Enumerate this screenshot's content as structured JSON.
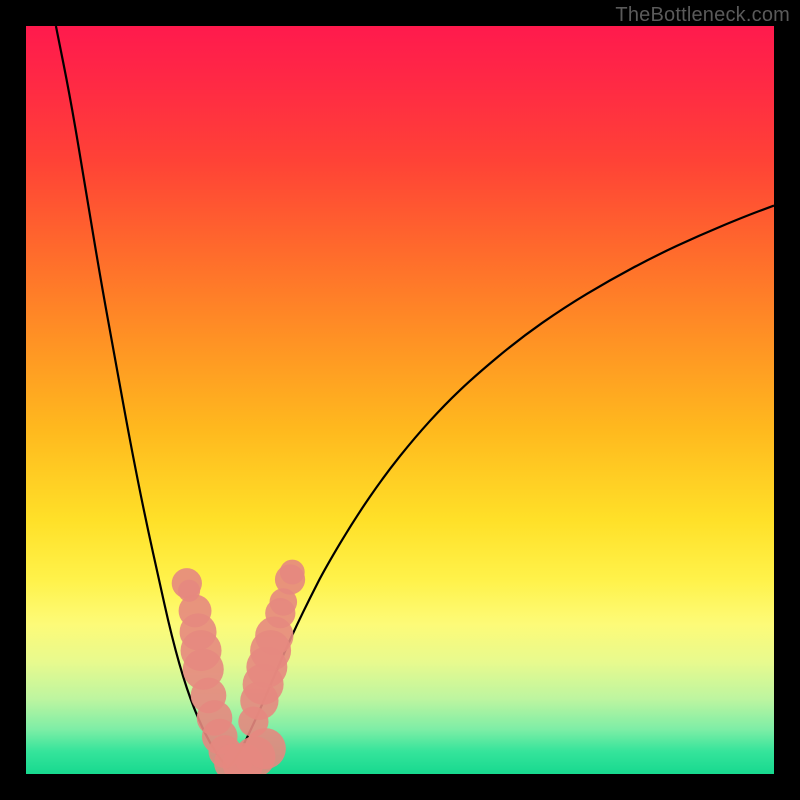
{
  "watermark": "TheBottleneck.com",
  "colors": {
    "curve": "#000000",
    "markers": "#e6887f",
    "frame": "#000000"
  },
  "chart_data": {
    "type": "line",
    "title": "",
    "xlabel": "",
    "ylabel": "",
    "xlim": [
      0,
      100
    ],
    "ylim": [
      0,
      100
    ],
    "grid": false,
    "series": [
      {
        "name": "left-branch",
        "x": [
          4,
          6,
          8,
          10,
          12,
          14,
          16,
          18,
          19,
          20,
          21,
          22,
          23,
          24,
          25,
          26,
          27
        ],
        "y": [
          100,
          90,
          78,
          66,
          55,
          44,
          34,
          25,
          20.5,
          16.5,
          13,
          10,
          7.5,
          5.3,
          3.5,
          2,
          0.8
        ]
      },
      {
        "name": "right-branch",
        "x": [
          27,
          28,
          29,
          30,
          31,
          32,
          34,
          36,
          38,
          40,
          44,
          48,
          52,
          56,
          60,
          66,
          72,
          78,
          84,
          90,
          96,
          100
        ],
        "y": [
          0.8,
          2,
          3.7,
          5.8,
          8,
          10.3,
          15,
          19.5,
          23.6,
          27.5,
          34.2,
          40,
          45,
          49.4,
          53.2,
          58.2,
          62.4,
          66,
          69.2,
          72,
          74.5,
          76
        ]
      }
    ],
    "markers": {
      "name": "highlighted-points",
      "points": [
        {
          "x": 21.5,
          "y": 25.5,
          "r": 1.8
        },
        {
          "x": 21.8,
          "y": 24.5,
          "r": 1.2
        },
        {
          "x": 22.6,
          "y": 21.8,
          "r": 2.0
        },
        {
          "x": 23.0,
          "y": 19,
          "r": 2.3
        },
        {
          "x": 23.4,
          "y": 16.5,
          "r": 2.6
        },
        {
          "x": 23.7,
          "y": 14,
          "r": 2.6
        },
        {
          "x": 24.4,
          "y": 10.5,
          "r": 2.2
        },
        {
          "x": 25.2,
          "y": 7.5,
          "r": 2.2
        },
        {
          "x": 25.9,
          "y": 5,
          "r": 2.2
        },
        {
          "x": 26.6,
          "y": 3,
          "r": 2.0
        },
        {
          "x": 27.7,
          "y": 1.5,
          "r": 2.4
        },
        {
          "x": 29.0,
          "y": 1.4,
          "r": 2.6
        },
        {
          "x": 30.6,
          "y": 2.3,
          "r": 2.6
        },
        {
          "x": 32.0,
          "y": 3.4,
          "r": 2.6
        },
        {
          "x": 30.4,
          "y": 7,
          "r": 1.8
        },
        {
          "x": 31.2,
          "y": 9.8,
          "r": 2.4
        },
        {
          "x": 31.7,
          "y": 12,
          "r": 2.6
        },
        {
          "x": 32.2,
          "y": 14.3,
          "r": 2.6
        },
        {
          "x": 32.7,
          "y": 16.5,
          "r": 2.6
        },
        {
          "x": 33.2,
          "y": 18.5,
          "r": 2.4
        },
        {
          "x": 34.0,
          "y": 21.5,
          "r": 1.8
        },
        {
          "x": 34.4,
          "y": 23,
          "r": 1.6
        },
        {
          "x": 35.3,
          "y": 26,
          "r": 1.8
        },
        {
          "x": 35.6,
          "y": 27,
          "r": 1.4
        }
      ]
    }
  }
}
